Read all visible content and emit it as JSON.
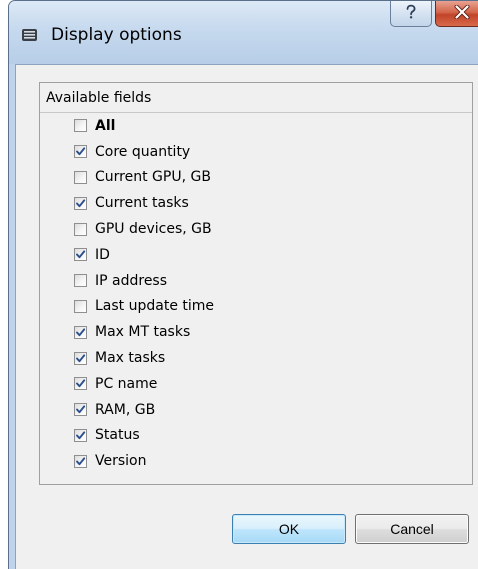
{
  "window": {
    "title": "Display options",
    "icon": "app-window-icon"
  },
  "titlebar_buttons": {
    "help_glyph": "?",
    "close_glyph": "X"
  },
  "group": {
    "header": "Available fields"
  },
  "fields": [
    {
      "label": "All",
      "checked": false,
      "bold": true
    },
    {
      "label": "Core quantity",
      "checked": true
    },
    {
      "label": "Current GPU, GB",
      "checked": false
    },
    {
      "label": "Current tasks",
      "checked": true
    },
    {
      "label": "GPU devices, GB",
      "checked": false
    },
    {
      "label": "ID",
      "checked": true
    },
    {
      "label": "IP address",
      "checked": false
    },
    {
      "label": "Last update time",
      "checked": false
    },
    {
      "label": "Max MT tasks",
      "checked": true
    },
    {
      "label": "Max tasks",
      "checked": true
    },
    {
      "label": "PC name",
      "checked": true
    },
    {
      "label": "RAM, GB",
      "checked": true
    },
    {
      "label": "Status",
      "checked": true
    },
    {
      "label": "Version",
      "checked": true
    }
  ],
  "buttons": {
    "ok": "OK",
    "cancel": "Cancel"
  },
  "colors": {
    "check_mark": "#2b4f8c",
    "ok_border": "#3c7fb1",
    "close_red": "#c1442a"
  }
}
